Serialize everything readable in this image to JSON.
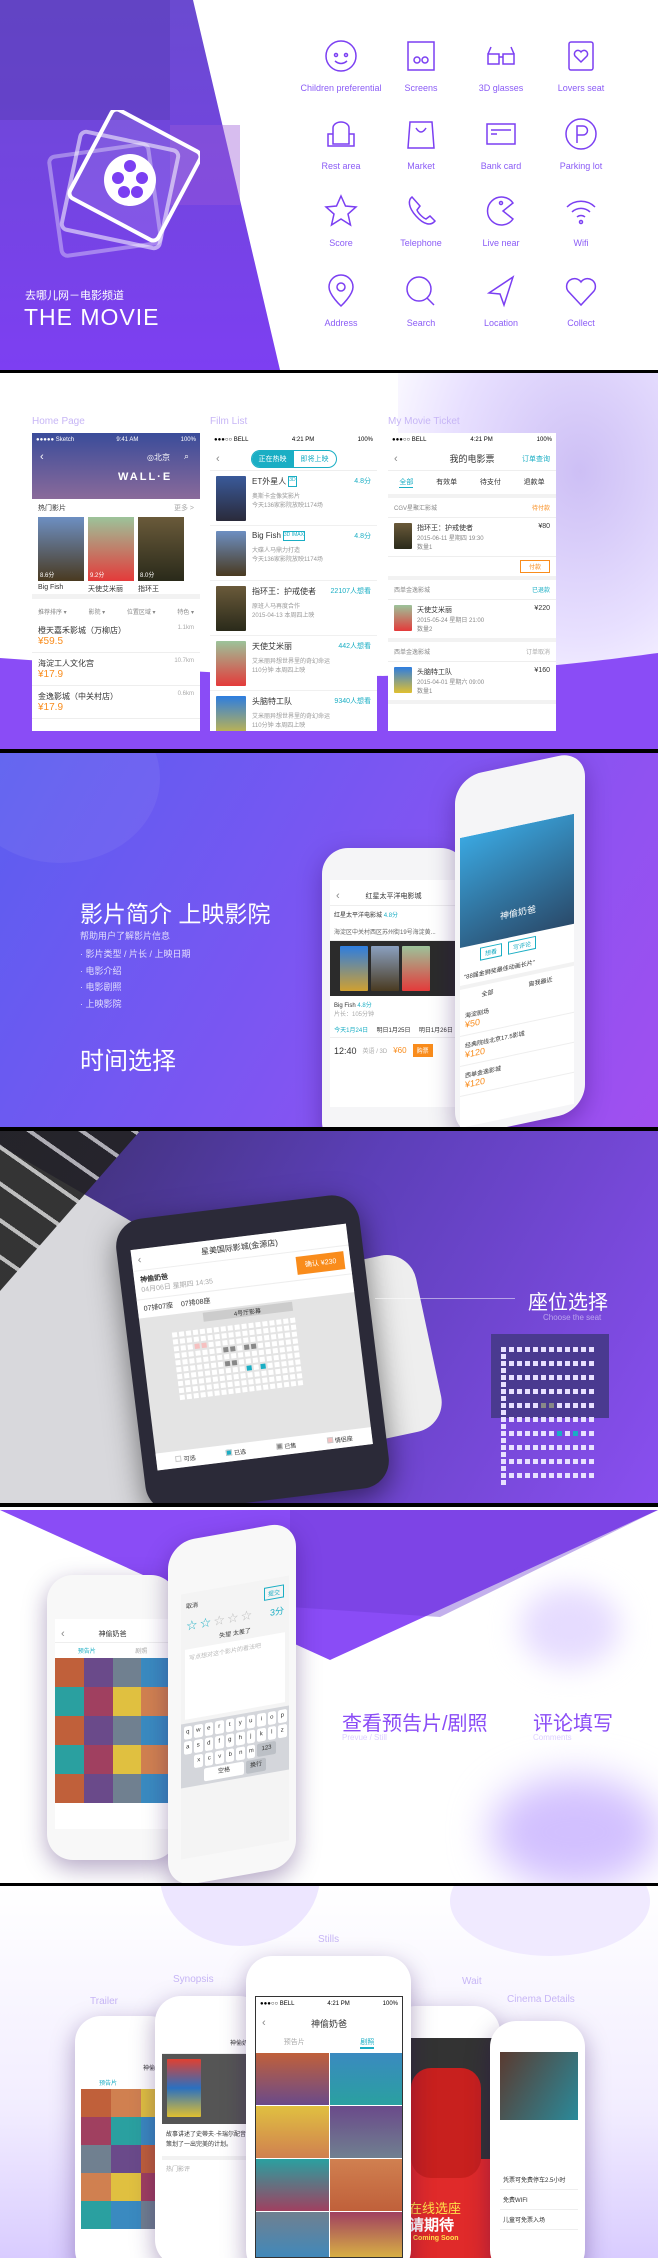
{
  "hero": {
    "subtitle": "去哪儿网－电影频道",
    "title": "THE MOVIE",
    "logo_icon": "film-reel-icon",
    "accent_color": "#7b3ff2",
    "icons": [
      {
        "label": "Children preferential",
        "icon": "child-face-icon"
      },
      {
        "label": "Screens",
        "icon": "screens-icon"
      },
      {
        "label": "3D glasses",
        "icon": "3d-glasses-icon"
      },
      {
        "label": "Lovers seat",
        "icon": "lovers-seat-icon"
      },
      {
        "label": "Rest area",
        "icon": "armchair-icon"
      },
      {
        "label": "Market",
        "icon": "shopping-bag-icon"
      },
      {
        "label": "Bank card",
        "icon": "bank-card-icon"
      },
      {
        "label": "Parking lot",
        "icon": "parking-icon"
      },
      {
        "label": "Score",
        "icon": "star-icon"
      },
      {
        "label": "Telephone",
        "icon": "telephone-icon"
      },
      {
        "label": "Live near",
        "icon": "live-near-icon"
      },
      {
        "label": "Wifi",
        "icon": "wifi-icon"
      },
      {
        "label": "Address",
        "icon": "map-pin-icon"
      },
      {
        "label": "Search",
        "icon": "search-icon"
      },
      {
        "label": "Location",
        "icon": "navigation-icon"
      },
      {
        "label": "Collect",
        "icon": "heart-icon"
      }
    ]
  },
  "screens": {
    "home": {
      "caption": "Home Page",
      "status": {
        "carrier": "●●●●● Sketch",
        "time": "9:41 AM",
        "battery": "100%"
      },
      "city": "北京",
      "banner_title": "WALL·E",
      "hot_title": "热门影片",
      "more": "更多 >",
      "films": [
        {
          "name": "Big Fish",
          "score": "8.6分"
        },
        {
          "name": "天使艾米丽",
          "score": "9.2分"
        },
        {
          "name": "指环王",
          "score": "8.0分"
        }
      ],
      "filters": [
        "推荐排序 ▾",
        "影院 ▾",
        "位置区域 ▾",
        "特色 ▾"
      ],
      "cinemas": [
        {
          "name": "橙天嘉禾影城（万柳店）",
          "dist": "1.1km",
          "price": "¥59.5"
        },
        {
          "name": "海淀工人文化宫",
          "dist": "10.7km",
          "price": "¥17.9"
        },
        {
          "name": "金逸影城（中关村店）",
          "dist": "0.6km",
          "price": "¥17.9"
        }
      ]
    },
    "film_list": {
      "caption": "Film List",
      "status": {
        "carrier": "●●●○○ BELL",
        "time": "4:21 PM",
        "battery": "100%"
      },
      "tabs": [
        "正在热映",
        "即将上映"
      ],
      "films": [
        {
          "name": "ET外星人",
          "tag": "3D",
          "right": "4.8分",
          "l1": "奥斯卡金像奖影片",
          "l2": "今天136家影院放映1174场"
        },
        {
          "name": "Big Fish",
          "tag": "3D IMAX",
          "right": "4.8分",
          "l1": "大碟人马鼎力打造",
          "l2": "今天136家影院放映1174场"
        },
        {
          "name": "指环王：护戒使者",
          "tag": "",
          "right": "22107人想看",
          "l1": "原班人马再度合作",
          "l2": "2015-04-13   本周四上映"
        },
        {
          "name": "天使艾米丽",
          "tag": "",
          "right": "442人想看",
          "l1": "艾米丽异想世界里的奇幻命运",
          "l2": "110分钟   本周四上映"
        },
        {
          "name": "头脑特工队",
          "tag": "",
          "right": "9340人想看",
          "l1": "艾米丽异想世界里的奇幻命运",
          "l2": "110分钟   本周四上映"
        }
      ]
    },
    "ticket": {
      "caption": "My Movie Ticket",
      "status": {
        "carrier": "●●●○○ BELL",
        "time": "4:21 PM",
        "battery": "100%"
      },
      "title": "我的电影票",
      "order_query": "订单查询",
      "tabs": [
        "全部",
        "有效单",
        "待支付",
        "退款单"
      ],
      "orders": [
        {
          "cinema": "CGV星聚汇影城",
          "state": "待付款",
          "film": "指环王：护戒使者",
          "price": "¥80",
          "time": "2015-06-11  星期四  19:30",
          "qty": "数量1",
          "action": "付款"
        },
        {
          "cinema": "西单金逸影城",
          "state": "已退款",
          "film": "天使艾米丽",
          "price": "¥220",
          "time": "2015-05-24  星期日  21:00",
          "qty": "数量2"
        },
        {
          "cinema": "西单金逸影城",
          "state": "订单取消",
          "film": "头脑特工队",
          "price": "¥160",
          "time": "2015-04-01  星期六  09:00",
          "qty": "数量1"
        }
      ]
    }
  },
  "intro": {
    "heading": "影片简介 上映影院",
    "desc": "帮助用户了解影片信息",
    "bullets": [
      "影片类型 / 片长 / 上映日期",
      "电影介绍",
      "电影剧照",
      "上映影院"
    ],
    "heading2": "时间选择",
    "cinema_phone": {
      "title": "红星太平洋电影城",
      "cinema": "红星太平洋电影城",
      "score": "4.8分",
      "address": "海淀区中关村西区苏州街19号海淀黄...",
      "film": "Big Fish",
      "film_score": "4.8分",
      "length": "片长：105分钟",
      "dates": [
        "今天1月24日",
        "明日1月25日",
        "明日1月26日"
      ],
      "show_time": "12:40",
      "show_lang": "英语 / 3D",
      "show_price": "¥60",
      "buy": "购票"
    },
    "detail_phone": {
      "film": "神偷奶爸",
      "quote": "\"88届金狮奖最佳动画长片\"",
      "want": "想看",
      "comment": "写评论",
      "filters": [
        "全部",
        "离我最近"
      ],
      "cinemas": [
        {
          "name": "海淀剧场",
          "price": "¥50"
        },
        {
          "name": "经典院线北京17.5影城",
          "price": "¥120"
        },
        {
          "name": "西单金逸影城",
          "price": "¥120"
        }
      ]
    }
  },
  "seat": {
    "heading": "座位选择",
    "subheading": "Choose the seat",
    "phone": {
      "title": "星美国际影城(金源店)",
      "film": "神偷奶爸",
      "confirm": "确认 ¥230",
      "time": "04月06日  星期四  14:35",
      "selected": [
        "07排07座",
        "07排08座"
      ],
      "screen": "4号厅影幕",
      "legend": [
        "可选",
        "已选",
        "已售",
        "情侣座"
      ]
    }
  },
  "media": {
    "heading1": "查看预告片/剧照",
    "sub1": "Prevue / Still",
    "heading2": "评论填写",
    "sub2": "Comments",
    "stills_phone": {
      "title": "神偷奶爸",
      "tabs": [
        "预告片",
        "剧照"
      ]
    },
    "comment_phone": {
      "cancel": "取消",
      "submit": "提交",
      "score": "3分",
      "rating": 1.5,
      "hint": "失望 太差了",
      "placeholder": "写点想对这个影片的看法吧",
      "keys": [
        "q",
        "w",
        "e",
        "r",
        "t",
        "y",
        "u",
        "i",
        "o",
        "p",
        "a",
        "s",
        "d",
        "f",
        "g",
        "h",
        "j",
        "k",
        "l",
        "z",
        "x",
        "c",
        "v",
        "b",
        "n",
        "m"
      ],
      "space": "空格",
      "return": "换行",
      "num": "123"
    }
  },
  "gallery": {
    "labels": [
      "Trailer",
      "Synopsis",
      "Stills",
      "Wait",
      "Cinema Details"
    ],
    "center": {
      "title": "神偷奶爸",
      "tabs": [
        "预告片",
        "剧照"
      ],
      "status": {
        "carrier": "●●●○○ BELL",
        "time": "4:21 PM",
        "battery": "100%"
      }
    },
    "synopsis": {
      "title": "神偷奶爸",
      "text": "故事讲述了史蒂夫·卡瑞尔配音，策划了一出完美的计划。",
      "hot": "热门影评"
    },
    "wait": {
      "cn": "在线选座",
      "cn2": "请期待",
      "en": "Coming Soon"
    },
    "details": {
      "items": [
        "凭票可免费停车2.5小时",
        "免费WIFI",
        "儿童可免票入场"
      ]
    }
  }
}
